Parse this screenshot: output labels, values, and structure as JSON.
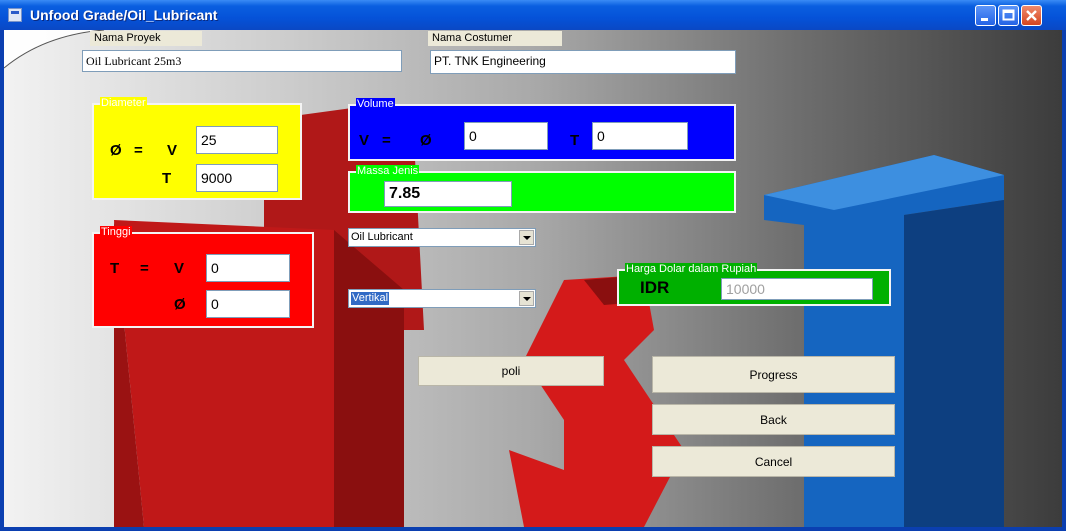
{
  "window": {
    "title": "Unfood Grade/Oil_Lubricant"
  },
  "project": {
    "name_label": "Nama Proyek",
    "name_value": "Oil Lubricant 25m3",
    "customer_label": "Nama Costumer",
    "customer_value": "PT. TNK Engineering"
  },
  "diameter": {
    "title": "Diameter",
    "formula_symbol": "Ø",
    "formula_eq": "=",
    "v_label": "V",
    "v_value": "25",
    "t_label": "T",
    "t_value": "9000",
    "color": "#ffff00"
  },
  "volume": {
    "title": "Volume",
    "v_label": "V",
    "eq": "=",
    "d_label": "Ø",
    "d_value": "0",
    "t_label": "T",
    "t_value": "0",
    "color": "#0000ff"
  },
  "density": {
    "title": "Massa Jenis",
    "value": "7.85",
    "color": "#00ff00"
  },
  "height": {
    "title": "Tinggi",
    "t_label": "T",
    "eq": "=",
    "v_label": "V",
    "v_value": "0",
    "d_label": "Ø",
    "d_value": "0",
    "color": "#ff0000"
  },
  "fluid_select": {
    "value": "Oil Lubricant"
  },
  "orientation_select": {
    "value": "Vertikal"
  },
  "exchange": {
    "title": "Harga Dolar dalam Rupiah",
    "currency": "IDR",
    "value": "10000",
    "color": "#00b000"
  },
  "buttons": {
    "poli": "poli",
    "progress": "Progress",
    "back": "Back",
    "cancel": "Cancel"
  }
}
